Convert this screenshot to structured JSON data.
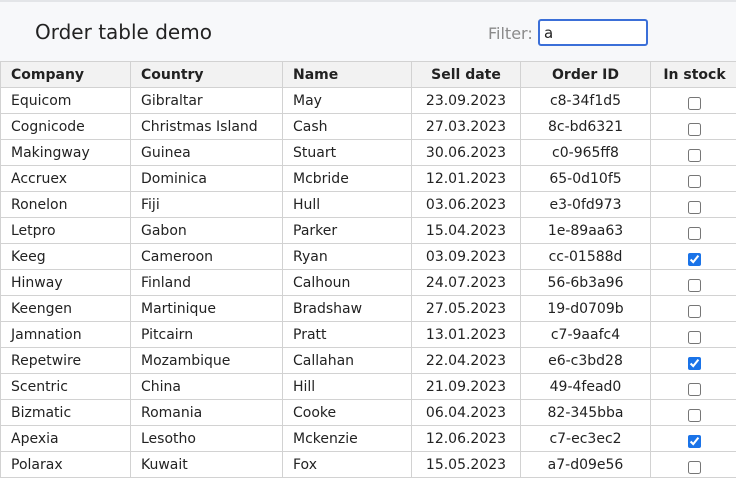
{
  "header": {
    "title": "Order table demo",
    "filter_label": "Filter:",
    "filter_value": "a"
  },
  "table": {
    "columns": [
      "Company",
      "Country",
      "Name",
      "Sell date",
      "Order ID",
      "In stock"
    ],
    "rows": [
      {
        "company": "Equicom",
        "country": "Gibraltar",
        "name": "May",
        "sell_date": "23.09.2023",
        "order_id": "c8-34f1d5",
        "in_stock": false
      },
      {
        "company": "Cognicode",
        "country": "Christmas Island",
        "name": "Cash",
        "sell_date": "27.03.2023",
        "order_id": "8c-bd6321",
        "in_stock": false
      },
      {
        "company": "Makingway",
        "country": "Guinea",
        "name": "Stuart",
        "sell_date": "30.06.2023",
        "order_id": "c0-965ff8",
        "in_stock": false
      },
      {
        "company": "Accruex",
        "country": "Dominica",
        "name": "Mcbride",
        "sell_date": "12.01.2023",
        "order_id": "65-0d10f5",
        "in_stock": false
      },
      {
        "company": "Ronelon",
        "country": "Fiji",
        "name": "Hull",
        "sell_date": "03.06.2023",
        "order_id": "e3-0fd973",
        "in_stock": false
      },
      {
        "company": "Letpro",
        "country": "Gabon",
        "name": "Parker",
        "sell_date": "15.04.2023",
        "order_id": "1e-89aa63",
        "in_stock": false
      },
      {
        "company": "Keeg",
        "country": "Cameroon",
        "name": "Ryan",
        "sell_date": "03.09.2023",
        "order_id": "cc-01588d",
        "in_stock": true
      },
      {
        "company": "Hinway",
        "country": "Finland",
        "name": "Calhoun",
        "sell_date": "24.07.2023",
        "order_id": "56-6b3a96",
        "in_stock": false
      },
      {
        "company": "Keengen",
        "country": "Martinique",
        "name": "Bradshaw",
        "sell_date": "27.05.2023",
        "order_id": "19-d0709b",
        "in_stock": false
      },
      {
        "company": "Jamnation",
        "country": "Pitcairn",
        "name": "Pratt",
        "sell_date": "13.01.2023",
        "order_id": "c7-9aafc4",
        "in_stock": false
      },
      {
        "company": "Repetwire",
        "country": "Mozambique",
        "name": "Callahan",
        "sell_date": "22.04.2023",
        "order_id": "e6-c3bd28",
        "in_stock": true
      },
      {
        "company": "Scentric",
        "country": "China",
        "name": "Hill",
        "sell_date": "21.09.2023",
        "order_id": "49-4fead0",
        "in_stock": false
      },
      {
        "company": "Bizmatic",
        "country": "Romania",
        "name": "Cooke",
        "sell_date": "06.04.2023",
        "order_id": "82-345bba",
        "in_stock": false
      },
      {
        "company": "Apexia",
        "country": "Lesotho",
        "name": "Mckenzie",
        "sell_date": "12.06.2023",
        "order_id": "c7-ec3ec2",
        "in_stock": true
      },
      {
        "company": "Polarax",
        "country": "Kuwait",
        "name": "Fox",
        "sell_date": "15.05.2023",
        "order_id": "a7-d09e56",
        "in_stock": false
      }
    ]
  }
}
